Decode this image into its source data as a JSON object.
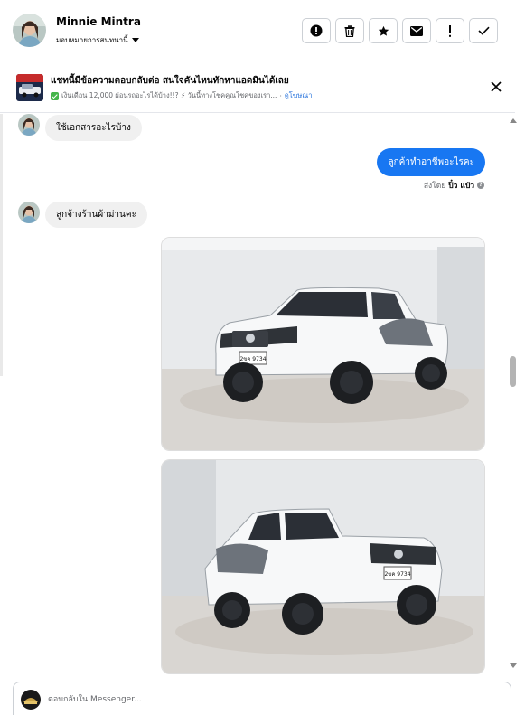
{
  "header": {
    "contact_name": "Minnie Mintra",
    "assign_label": "มอบหมายการสนทนานี้",
    "actions": [
      {
        "name": "mark-spam-button",
        "icon": "alert-circle-icon"
      },
      {
        "name": "delete-button",
        "icon": "trash-icon"
      },
      {
        "name": "star-button",
        "icon": "star-icon"
      },
      {
        "name": "mark-unread-button",
        "icon": "envelope-icon"
      },
      {
        "name": "follow-up-button",
        "icon": "exclamation-icon"
      },
      {
        "name": "mark-done-button",
        "icon": "check-icon"
      }
    ]
  },
  "ad": {
    "title": "แชทนี้มีข้อความตอบกลับต่อ สนใจคันไหนทักหาแอดมินได้เลย",
    "subtitle": "เงินเดือน 12,000 ผ่อนรถอะไรได้บ้าง!!? ⚡ วันนี้ทางโชคคูณโชคของเรา...",
    "link_label": "ดูโฆษณา"
  },
  "messages": [
    {
      "from": "contact",
      "text": "ใช้เอกสารอะไรบ้าง"
    },
    {
      "from": "page",
      "text": "ลูกค้าทำอาชีพอะไรคะ"
    },
    {
      "from": "contact",
      "text": "ลูกจ้างร้านผ้าม่านคะ"
    }
  ],
  "sent_by": {
    "prefix": "ส่งโดย",
    "name": "ปิ๋ว แป๋ว"
  },
  "photos": [
    {
      "plate": "2ขค 9734",
      "desc": "white-pickup-front-left"
    },
    {
      "plate": "2ขค 9734",
      "desc": "white-pickup-front-right"
    }
  ],
  "composer": {
    "placeholder": "ตอบกลับใน Messenger..."
  },
  "colors": {
    "accent": "#1877f2",
    "incoming_bubble": "#f0f0f0",
    "muted_text": "#65676b"
  }
}
